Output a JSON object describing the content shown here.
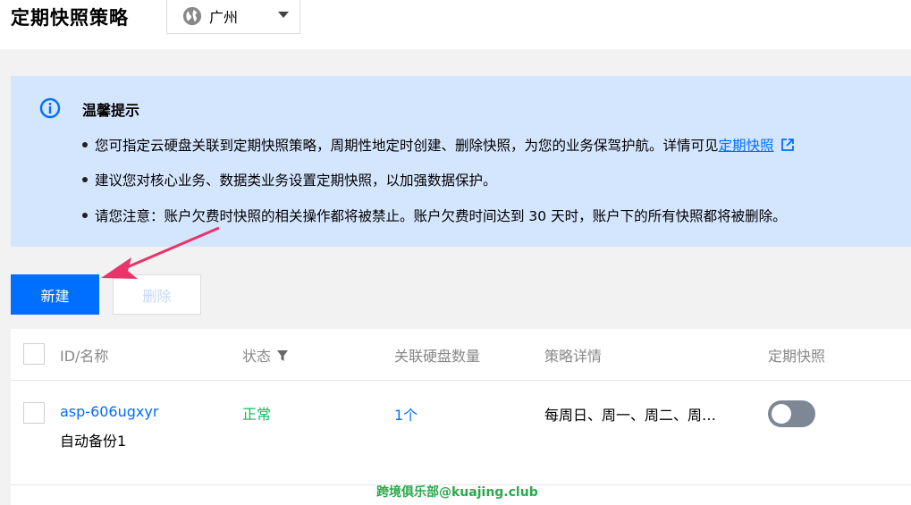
{
  "header": {
    "title": "定期快照策略",
    "region": {
      "label": "广州",
      "icon": "globe-icon"
    }
  },
  "notice": {
    "icon": "info-icon",
    "title": "温馨提示",
    "items": [
      {
        "text": "您可指定云硬盘关联到定期快照策略，周期性地定时创建、删除快照，为您的业务保驾护航。详情可见",
        "link": "定期快照"
      },
      {
        "text": "建议您对核心业务、数据类业务设置定期快照，以加强数据保护。"
      },
      {
        "text": "请您注意：账户欠费时快照的相关操作都将被禁止。账户欠费时间达到 30 天时，账户下的所有快照都将被删除。"
      }
    ]
  },
  "toolbar": {
    "new_label": "新建",
    "delete_label": "删除"
  },
  "table": {
    "columns": [
      "ID/名称",
      "状态",
      "关联硬盘数量",
      "策略详情",
      "定期快照"
    ],
    "rows": [
      {
        "id": "asp-606ugxyr",
        "name": "自动备份1",
        "status": "正常",
        "disks": "1个",
        "detail": "每周日、周一、周二、周…",
        "toggle_on": false
      }
    ]
  },
  "colors": {
    "accent": "#006eff",
    "notice_bg": "#d4e5fe",
    "status_ok": "#0abf5b",
    "arrow": "#e8336b"
  },
  "watermark": "跨境俱乐部@kuajing.club"
}
